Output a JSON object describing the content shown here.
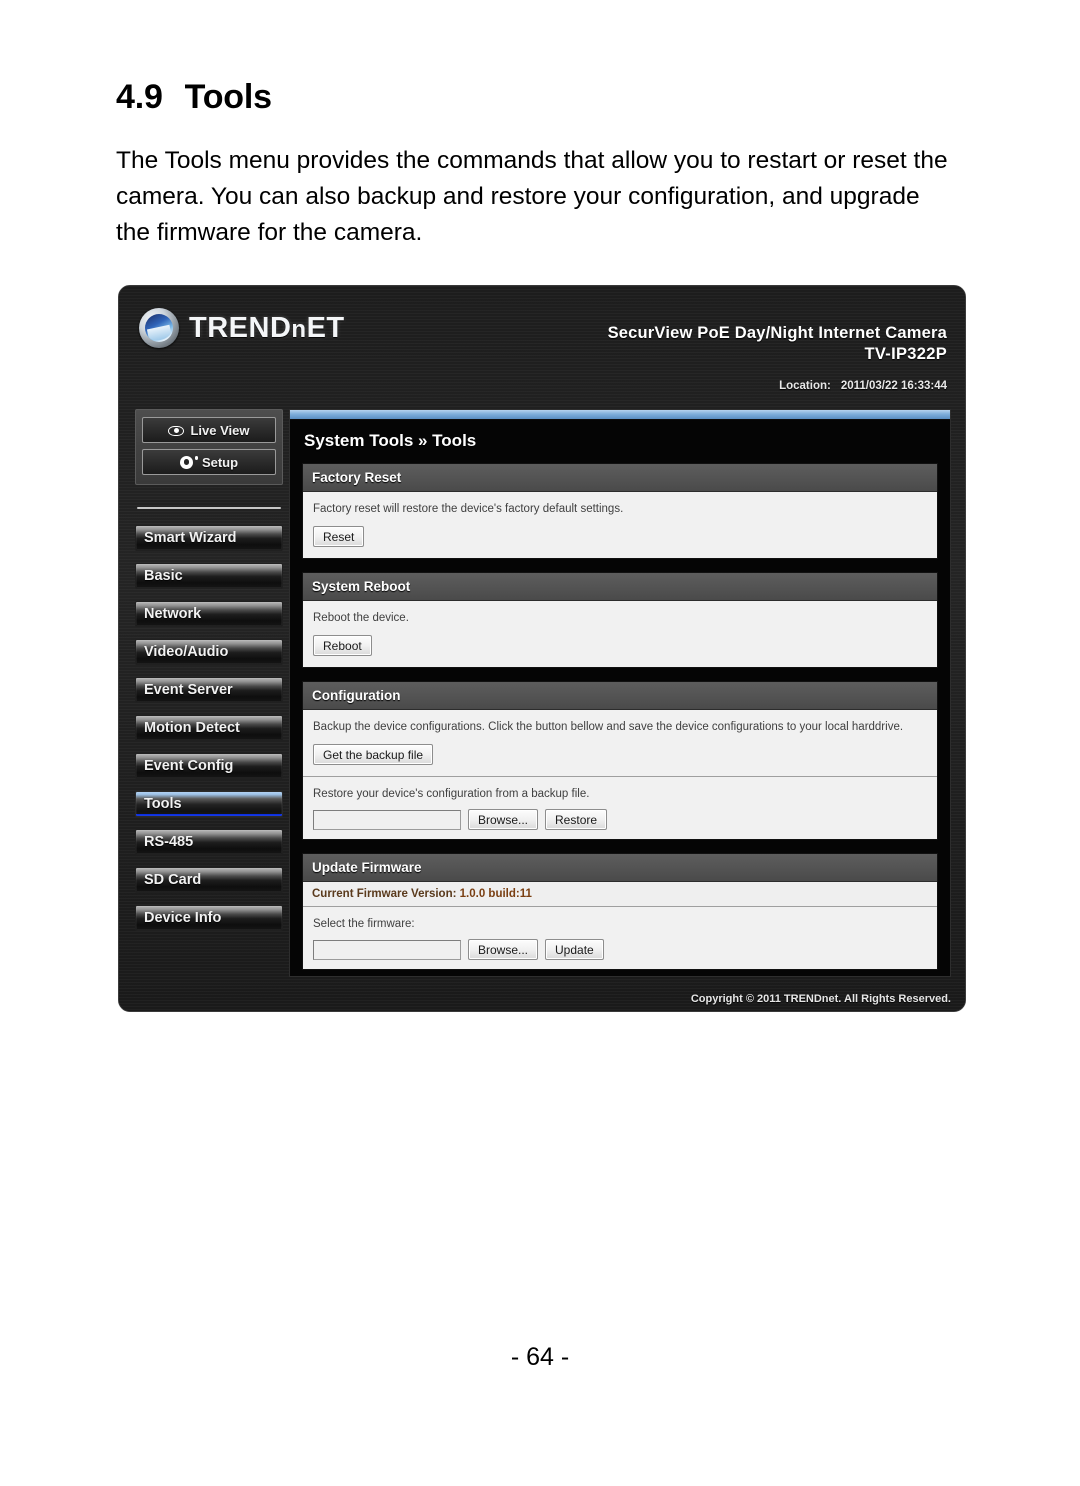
{
  "document": {
    "section_number": "4.9",
    "section_title": "Tools",
    "intro_paragraph": "The Tools menu provides the commands that allow you to restart or reset the camera. You can also backup and restore your configuration, and upgrade the firmware for the camera.",
    "page_number": "- 64 -"
  },
  "screenshot": {
    "header": {
      "brand_main": "TREND",
      "brand_sub": "n",
      "brand_tail": "ET",
      "brand_full": "TRENDnET",
      "product_name": "SecurView PoE Day/Night Internet Camera",
      "model": "TV-IP322P",
      "location_label": "Location:",
      "location_value": "2011/03/22 16:33:44"
    },
    "sidebar": {
      "top_buttons": [
        {
          "label": "Live View",
          "icon": "eye-icon"
        },
        {
          "label": "Setup",
          "icon": "gear-icon"
        }
      ],
      "items": [
        {
          "label": "Smart Wizard",
          "active": false
        },
        {
          "label": "Basic",
          "active": false
        },
        {
          "label": "Network",
          "active": false
        },
        {
          "label": "Video/Audio",
          "active": false
        },
        {
          "label": "Event Server",
          "active": false
        },
        {
          "label": "Motion Detect",
          "active": false
        },
        {
          "label": "Event Config",
          "active": false
        },
        {
          "label": "Tools",
          "active": true
        },
        {
          "label": "RS-485",
          "active": false
        },
        {
          "label": "SD Card",
          "active": false
        },
        {
          "label": "Device Info",
          "active": false
        }
      ]
    },
    "content": {
      "breadcrumb": "System Tools » Tools",
      "factory_reset": {
        "title": "Factory Reset",
        "description": "Factory reset will restore the device's factory default settings.",
        "button": "Reset"
      },
      "system_reboot": {
        "title": "System Reboot",
        "description": "Reboot the device.",
        "button": "Reboot"
      },
      "configuration": {
        "title": "Configuration",
        "backup_description": "Backup the device configurations. Click the button bellow and save the device configurations to your local harddrive.",
        "backup_button": "Get the backup file",
        "restore_description": "Restore your device's configuration from a backup file.",
        "restore_input_value": "",
        "browse_button": "Browse...",
        "restore_button": "Restore"
      },
      "update_firmware": {
        "title": "Update Firmware",
        "version_label": "Current Firmware Version:",
        "version_value": "1.0.0 build:11",
        "select_label": "Select the firmware:",
        "firmware_input_value": "",
        "browse_button": "Browse...",
        "update_button": "Update"
      }
    },
    "footer": {
      "copyright": "Copyright © 2011 TRENDnet. All Rights Reserved."
    },
    "colors": {
      "accent_blue": "#0b2fe0",
      "topbar_blue": "#7fafdc",
      "panel_header": "#545454",
      "panel_body": "#f1f1f1"
    }
  }
}
